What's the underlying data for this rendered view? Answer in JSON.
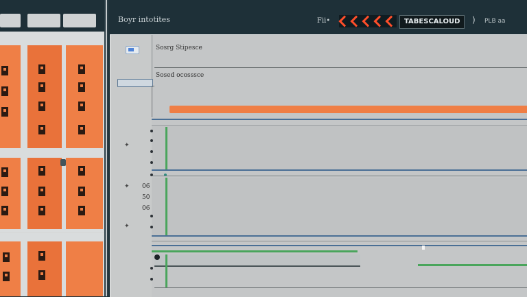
{
  "topbar": {
    "title": "Boyr intotites",
    "filter_label": "Fii•",
    "badge_text": "TABESCALOUD",
    "badge_close": ")",
    "right_text": "PLB aa"
  },
  "panel": {
    "label_primary": "Sosrg Stipesce",
    "label_secondary": "Sosed ocosssce"
  },
  "axis": {
    "numbers": [
      "06",
      "50",
      "06"
    ]
  },
  "colors": {
    "accent": "#ef7f46",
    "alert": "#ff4e2a",
    "progress": "#4aa55c",
    "selection": "#4f84d8",
    "dark_bg": "#1e3038"
  },
  "icons": {
    "chevrons": "double-chevron-icon",
    "toggle": "toggle-icon",
    "markers": "star-marker-icon"
  }
}
